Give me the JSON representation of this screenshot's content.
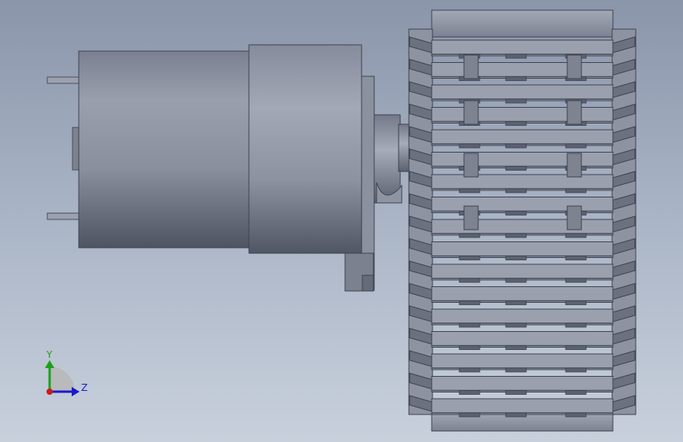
{
  "viewport": {
    "background_top": "#8a95aa",
    "background_bottom": "#c8d0dc"
  },
  "model": {
    "motor_body_color": "#8a90a0",
    "motor_shadow_color": "#4a5060",
    "track_color": "#9aa0b0",
    "track_dark_color": "#5a6070"
  },
  "triad": {
    "y_label": "Y",
    "z_label": "Z",
    "y_color": "#1aa11a",
    "z_color": "#1a1acc",
    "x_color": "#cc1a1a",
    "arc_color": "#b8b8b8"
  }
}
